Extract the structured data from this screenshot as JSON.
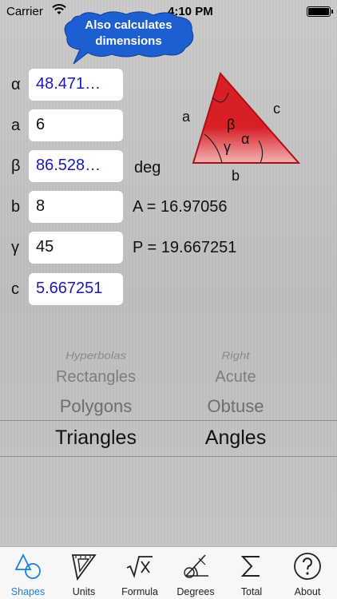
{
  "status_bar": {
    "carrier": "Carrier",
    "time": "4:10 PM"
  },
  "callout": {
    "line1": "Also calculates",
    "line2": "dimensions"
  },
  "rows": [
    {
      "label": "α",
      "value": "48.471…",
      "calculated": true
    },
    {
      "label": "a",
      "value": "6",
      "calculated": false
    },
    {
      "label": "β",
      "value": "86.528…",
      "calculated": true
    },
    {
      "label": "b",
      "value": "8",
      "calculated": false
    },
    {
      "label": "γ",
      "value": "45",
      "calculated": false
    },
    {
      "label": "c",
      "value": "5.667251",
      "calculated": true
    }
  ],
  "notes": {
    "unit": "deg",
    "area": "A = 16.97056",
    "perimeter": "P = 19.667251"
  },
  "diagram": {
    "side_a": "a",
    "side_b": "b",
    "side_c": "c",
    "angle_alpha": "α",
    "angle_beta": "β",
    "angle_gamma": "γ"
  },
  "picker": {
    "shapes": [
      "Hyperbolas",
      "Rectangles",
      "Polygons",
      "Triangles"
    ],
    "angles": [
      "Right",
      "Acute",
      "Obtuse",
      "Angles"
    ]
  },
  "tabs": [
    {
      "label": "Shapes",
      "icon": "shapes-icon",
      "active": true
    },
    {
      "label": "Units",
      "icon": "set-square-icon",
      "active": false
    },
    {
      "label": "Formula",
      "icon": "formula-icon",
      "active": false
    },
    {
      "label": "Degrees",
      "icon": "protractor-icon",
      "active": false
    },
    {
      "label": "Total",
      "icon": "sigma-icon",
      "active": false
    },
    {
      "label": "About",
      "icon": "question-icon",
      "active": false
    }
  ],
  "colors": {
    "calculated_text": "#1a1ab8",
    "callout_fill": "#1d5fd0",
    "triangle_red": "#d81f26",
    "active_tab": "#1b7fe0"
  }
}
